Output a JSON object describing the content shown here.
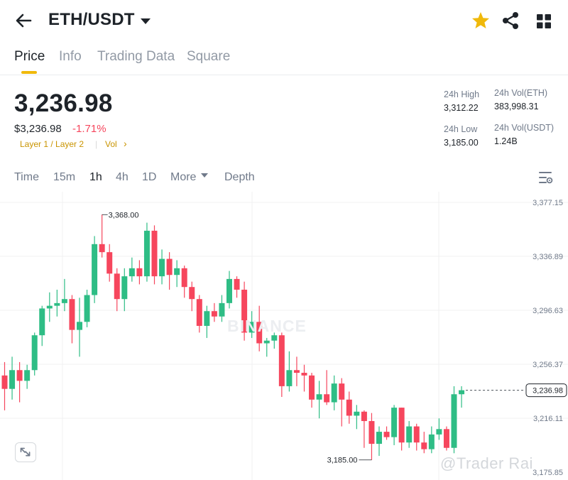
{
  "header": {
    "pair": "ETH/USDT",
    "icons": [
      "back-arrow-icon",
      "caret-down-icon",
      "star-icon",
      "share-icon",
      "grid-menu-icon"
    ]
  },
  "tabs": [
    {
      "label": "Price",
      "active": true
    },
    {
      "label": "Info"
    },
    {
      "label": "Trading Data"
    },
    {
      "label": "Square"
    }
  ],
  "price": {
    "last": "3,236.98",
    "usd": "$3,236.98",
    "change": "-1.71%",
    "tags": [
      "Layer 1 / Layer 2",
      "Vol"
    ]
  },
  "stats": {
    "high_label": "24h High",
    "high": "3,312.22",
    "low_label": "24h Low",
    "low": "3,185.00",
    "vol_eth_label": "24h Vol(ETH)",
    "vol_eth": "383,998.31",
    "vol_usdt_label": "24h Vol(USDT)",
    "vol_usdt": "1.24B"
  },
  "intervals": [
    {
      "label": "Time"
    },
    {
      "label": "15m"
    },
    {
      "label": "1h",
      "active": true
    },
    {
      "label": "4h"
    },
    {
      "label": "1D"
    },
    {
      "label": "More"
    },
    {
      "label": "Depth"
    }
  ],
  "colors": {
    "up": "#2ebd85",
    "down": "#f6465d",
    "accent": "#f0b90b"
  },
  "chart_data": {
    "type": "candlestick",
    "y_ticks": [
      "3,377.15",
      "3,336.89",
      "3,296.63",
      "3,256.37",
      "3,216.11",
      "3,175.85"
    ],
    "ylim": [
      3175.85,
      3377.15
    ],
    "last_price_label": "3,236.98",
    "last_price": 3236.98,
    "high_annotation": "3,368.00",
    "low_annotation": "3,185.00",
    "candles": [
      [
        3248,
        3238,
        3258,
        3222
      ],
      [
        3238,
        3252,
        3262,
        3230
      ],
      [
        3252,
        3244,
        3258,
        3228
      ],
      [
        3244,
        3252,
        3256,
        3238
      ],
      [
        3252,
        3278,
        3280,
        3248
      ],
      [
        3278,
        3298,
        3300,
        3270
      ],
      [
        3298,
        3300,
        3310,
        3288
      ],
      [
        3300,
        3302,
        3312,
        3292
      ],
      [
        3302,
        3305,
        3320,
        3296
      ],
      [
        3305,
        3282,
        3308,
        3272
      ],
      [
        3282,
        3288,
        3306,
        3262
      ],
      [
        3288,
        3308,
        3312,
        3284
      ],
      [
        3308,
        3346,
        3352,
        3302
      ],
      [
        3346,
        3340,
        3368,
        3336
      ],
      [
        3340,
        3324,
        3346,
        3318
      ],
      [
        3324,
        3305,
        3328,
        3296
      ],
      [
        3305,
        3322,
        3328,
        3296
      ],
      [
        3322,
        3328,
        3336,
        3318
      ],
      [
        3328,
        3322,
        3334,
        3316
      ],
      [
        3322,
        3356,
        3362,
        3318
      ],
      [
        3356,
        3322,
        3360,
        3316
      ],
      [
        3322,
        3335,
        3342,
        3316
      ],
      [
        3335,
        3323,
        3340,
        3312
      ],
      [
        3323,
        3328,
        3334,
        3314
      ],
      [
        3328,
        3314,
        3330,
        3306
      ],
      [
        3314,
        3305,
        3318,
        3296
      ],
      [
        3305,
        3285,
        3308,
        3280
      ],
      [
        3285,
        3296,
        3300,
        3276
      ],
      [
        3296,
        3292,
        3302,
        3288
      ],
      [
        3292,
        3302,
        3308,
        3288
      ],
      [
        3302,
        3320,
        3326,
        3298
      ],
      [
        3320,
        3312,
        3322,
        3306
      ],
      [
        3312,
        3280,
        3318,
        3274
      ],
      [
        3280,
        3288,
        3296,
        3276
      ],
      [
        3288,
        3272,
        3300,
        3266
      ],
      [
        3272,
        3274,
        3276,
        3262
      ],
      [
        3274,
        3278,
        3280,
        3268
      ],
      [
        3278,
        3240,
        3280,
        3232
      ],
      [
        3240,
        3252,
        3266,
        3236
      ],
      [
        3252,
        3250,
        3262,
        3240
      ],
      [
        3250,
        3248,
        3256,
        3236
      ],
      [
        3248,
        3230,
        3250,
        3224
      ],
      [
        3230,
        3234,
        3244,
        3216
      ],
      [
        3234,
        3228,
        3252,
        3226
      ],
      [
        3228,
        3242,
        3248,
        3222
      ],
      [
        3242,
        3230,
        3246,
        3210
      ],
      [
        3230,
        3218,
        3236,
        3212
      ],
      [
        3218,
        3221,
        3226,
        3208
      ],
      [
        3221,
        3214,
        3222,
        3194
      ],
      [
        3214,
        3197,
        3220,
        3185
      ],
      [
        3197,
        3206,
        3210,
        3188
      ],
      [
        3206,
        3202,
        3210,
        3200
      ],
      [
        3202,
        3224,
        3226,
        3196
      ],
      [
        3224,
        3198,
        3224,
        3192
      ],
      [
        3198,
        3210,
        3214,
        3194
      ],
      [
        3210,
        3198,
        3212,
        3192
      ],
      [
        3198,
        3193,
        3206,
        3190
      ],
      [
        3193,
        3204,
        3210,
        3190
      ],
      [
        3204,
        3208,
        3216,
        3200
      ],
      [
        3208,
        3194,
        3210,
        3192
      ],
      [
        3194,
        3234,
        3240,
        3190
      ],
      [
        3234,
        3237,
        3240,
        3224
      ]
    ]
  },
  "watermarks": {
    "brand": "BINANCE",
    "author": "@Trader Rai"
  }
}
